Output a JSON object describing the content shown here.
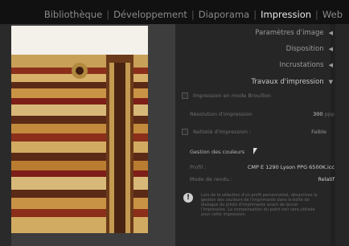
{
  "modules": [
    "Bibliothèque",
    "Développement",
    "Diaporama",
    "Impression",
    "Web"
  ],
  "active_module": "Impression",
  "panels": {
    "parametres_image": "Paramètres d'image",
    "disposition": "Disposition",
    "incrustations": "Incrustations",
    "travaux_impression": "Travaux d'impression"
  },
  "print_job": {
    "draft_label": "Impression en mode Brouillon",
    "resolution_label": "Résolution d'impression",
    "resolution_value": "300",
    "resolution_unit": "ppp",
    "sharpen_label": "Netteté d'impression :",
    "sharpen_value": "Faible",
    "color_mgmt_label": "Gestion des couleurs",
    "profile_label": "Profil :",
    "profile_value": "CMP E 1290 Lyson PPG 6500K.icc",
    "intent_label": "Mode de rendu :",
    "intent_value": "Relatif",
    "note": "Lors de la sélection d'un profil personnalisé, désactivez la gestion des couleurs de l'imprimante dans la boîte de dialogue du pilote d'imprimante avant de lancer l'impression. La compensation du point noir sera utilisée pour cette impression."
  }
}
